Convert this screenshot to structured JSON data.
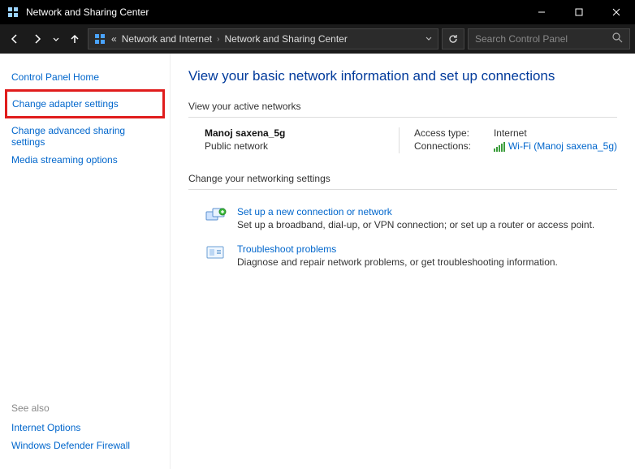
{
  "window": {
    "title": "Network and Sharing Center"
  },
  "breadcrumb": {
    "prefix": "«",
    "parent": "Network and Internet",
    "current": "Network and Sharing Center"
  },
  "search": {
    "placeholder": "Search Control Panel"
  },
  "sidebar": {
    "home": "Control Panel Home",
    "change_adapter": "Change adapter settings",
    "change_advanced": "Change advanced sharing settings",
    "media_streaming": "Media streaming options",
    "see_also_label": "See also",
    "internet_options": "Internet Options",
    "defender_firewall": "Windows Defender Firewall"
  },
  "main": {
    "title": "View your basic network information and set up connections",
    "active_label": "View your active networks",
    "network": {
      "name": "Manoj saxena_5g",
      "type": "Public network",
      "access_type_label": "Access type:",
      "access_type_value": "Internet",
      "connections_label": "Connections:",
      "connection_link": "Wi-Fi (Manoj saxena_5g)"
    },
    "change_label": "Change your networking settings",
    "setup": {
      "title": "Set up a new connection or network",
      "desc": "Set up a broadband, dial-up, or VPN connection; or set up a router or access point."
    },
    "troubleshoot": {
      "title": "Troubleshoot problems",
      "desc": "Diagnose and repair network problems, or get troubleshooting information."
    }
  }
}
